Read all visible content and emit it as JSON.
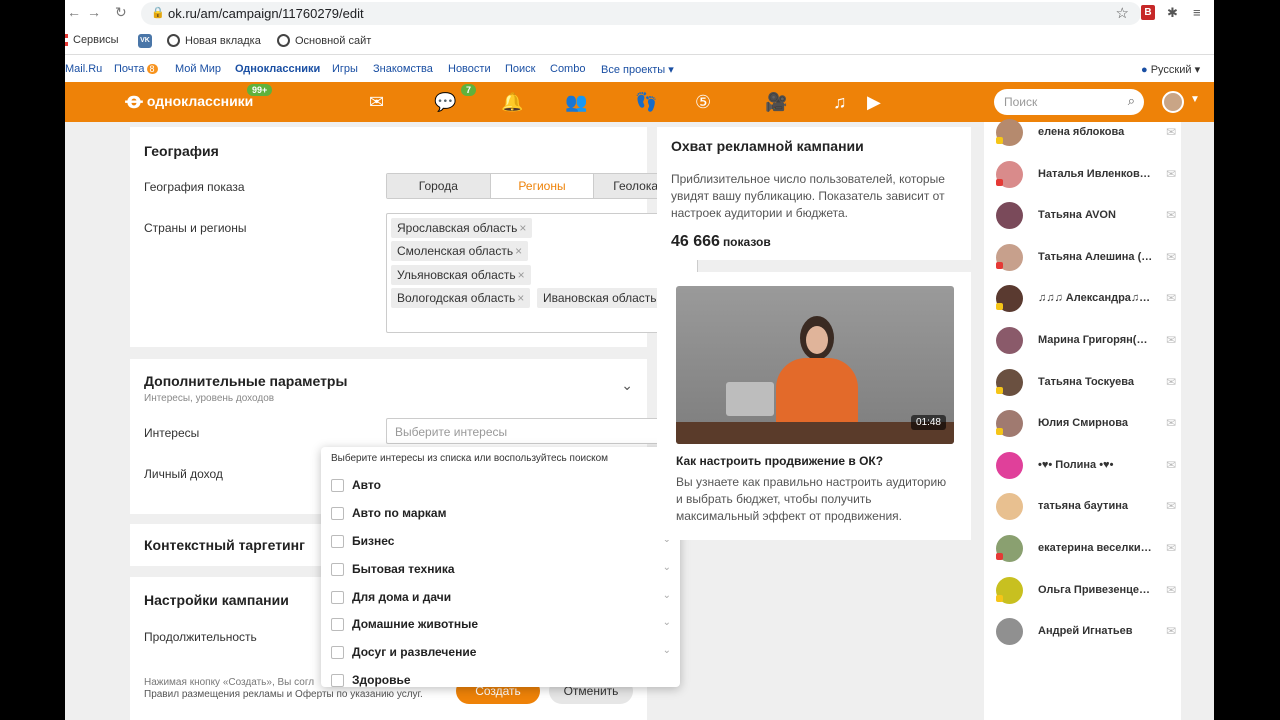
{
  "browser": {
    "url": "ok.ru/am/campaign/11760279/edit",
    "bookmarks": [
      "Сервисы",
      "Новая вкладка",
      "Основной сайт"
    ],
    "ext_badge": "B"
  },
  "portal": {
    "links": [
      "Mail.Ru",
      "Почта",
      "Мой Мир",
      "Одноклассники",
      "Игры",
      "Знакомства",
      "Новости",
      "Поиск",
      "Combo",
      "Все проекты ▾"
    ],
    "mail_badge": "8",
    "language": "Русский ▾"
  },
  "ok_header": {
    "logo": "одноклассники",
    "logo_badge": "99+",
    "discussions_badge": "7",
    "search_placeholder": "Поиск"
  },
  "geography": {
    "title": "География",
    "show_label": "География показа",
    "tabs": [
      "Города",
      "Регионы",
      "Геолокация"
    ],
    "active_tab": "Регионы",
    "regions_label": "Страны и регионы",
    "regions": [
      "Ярославская область",
      "Смоленская область",
      "Ульяновская область",
      "Вологодская область",
      "Ивановская область"
    ]
  },
  "additional": {
    "title": "Дополнительные параметры",
    "subtitle": "Интересы, уровень доходов",
    "interests_label": "Интересы",
    "interests_placeholder": "Выберите интересы",
    "income_label": "Личный доход"
  },
  "dropdown": {
    "hint": "Выберите интересы из списка или воспользуйтесь поиском",
    "items": [
      "Авто",
      "Авто по маркам",
      "Бизнес",
      "Бытовая техника",
      "Для дома и дачи",
      "Домашние животные",
      "Досуг и развлечение",
      "Здоровье"
    ]
  },
  "context": {
    "title": "Контекстный таргетинг"
  },
  "settings": {
    "title": "Настройки кампании",
    "duration_label": "Продолжительность",
    "terms_line1": "Нажимая кнопку «Создать», Вы согл",
    "terms_line2": "Правил размещения рекламы и Оферты по указанию услуг.",
    "create_label": "Создать",
    "cancel_label": "Отменить"
  },
  "reach": {
    "title": "Охват рекламной кампании",
    "text": "Приблизительное число пользователей, которые увидят вашу публикацию. Показатель зависит от настроек аудитории и бюджета.",
    "count": "46 666",
    "unit": "показов"
  },
  "video": {
    "duration": "01:48",
    "title": "Как настроить продвижение в ОК?",
    "desc": "Вы узнаете как правильно настроить аудиторию и выбрать бюджет, чтобы получить максимальный эффект от продвижения."
  },
  "friends": [
    {
      "name": "елена яблокова",
      "color": "#b58a6e",
      "dot": "#f5c518"
    },
    {
      "name": "Наталья Ивленкова (Ворсулева)",
      "color": "#d98b8b",
      "dot": "#e53935"
    },
    {
      "name": "Татьяна AVON",
      "color": "#7a4a5a",
      "dot": ""
    },
    {
      "name": "Татьяна Алешина (Скворцова)",
      "color": "#c7a08c",
      "dot": "#e53935"
    },
    {
      "name": "♫♫♫ Александра♫♫♫",
      "color": "#5a3a30",
      "dot": "#f5c518"
    },
    {
      "name": "Марина Григорян(Алексанян)",
      "color": "#8a5a6a",
      "dot": ""
    },
    {
      "name": "Татьяна Тоскуева",
      "color": "#6a5040",
      "dot": "#f5c518"
    },
    {
      "name": "Юлия Смирнова",
      "color": "#a07a70",
      "dot": "#f5c518"
    },
    {
      "name": "•♥• Полина •♥•",
      "color": "#e0409a",
      "dot": ""
    },
    {
      "name": "татьяна баутина",
      "color": "#e8c090",
      "dot": ""
    },
    {
      "name": "екатерина веселкина",
      "color": "#8aa070",
      "dot": "#e53935"
    },
    {
      "name": "Ольга Привезенцева (Лысенко)",
      "color": "#c8c020",
      "dot": "#f5c518"
    },
    {
      "name": "Андрей Игнатьев",
      "color": "#909090",
      "dot": ""
    }
  ],
  "colors": {
    "ok_orange": "#ee8208",
    "link_blue": "#1a4fa3",
    "online_green": "#5fb23c"
  }
}
